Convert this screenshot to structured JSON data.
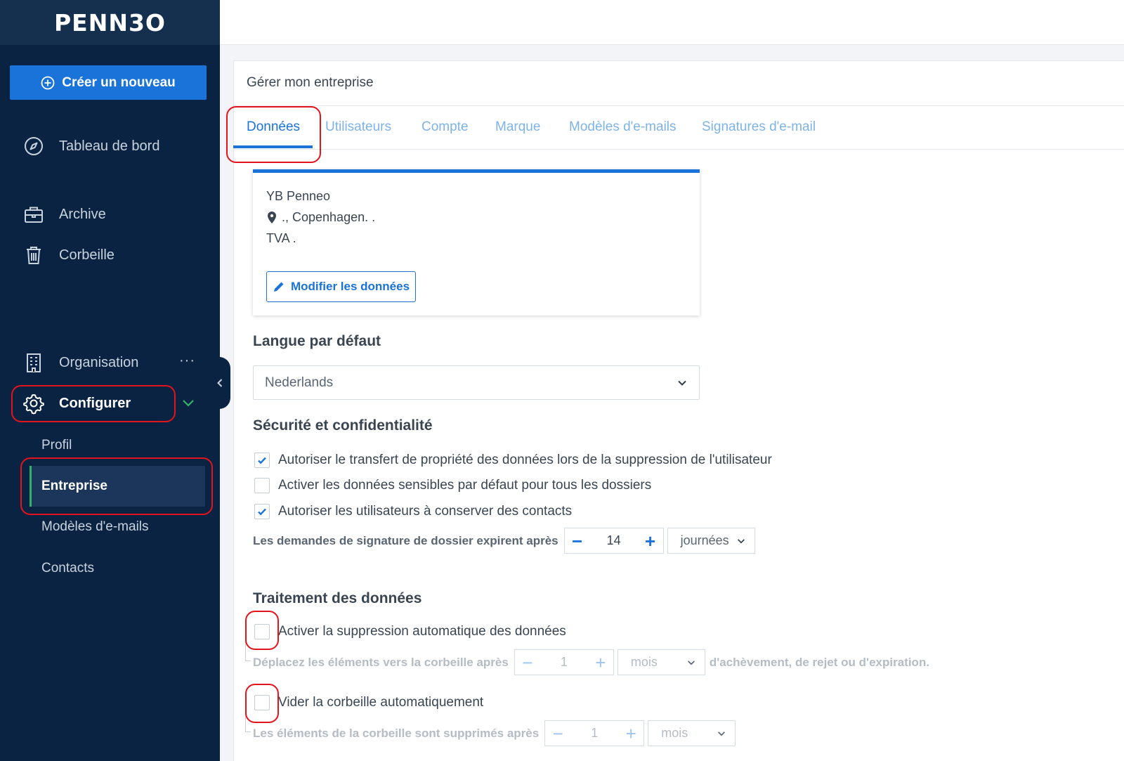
{
  "brand": {
    "logo": "PENN3O",
    "accent": "#1a73d9",
    "sidebar_bg": "#0a2342",
    "highlight": "#e3141c"
  },
  "sidebar": {
    "create_label": "Créer un nouveau",
    "items": [
      {
        "label": "Tableau de bord",
        "icon": "compass-icon"
      },
      {
        "label": "Archive",
        "icon": "briefcase-icon"
      },
      {
        "label": "Corbeille",
        "icon": "trash-icon"
      },
      {
        "label": "Organisation",
        "icon": "building-icon"
      },
      {
        "label": "Configurer",
        "icon": "gear-icon"
      }
    ],
    "more": "···",
    "subitems": [
      {
        "label": "Profil"
      },
      {
        "label": "Entreprise"
      },
      {
        "label": "Modèles d'e-mails"
      },
      {
        "label": "Contacts"
      }
    ]
  },
  "panel": {
    "title": "Gérer mon entreprise",
    "tabs": [
      {
        "label": "Données"
      },
      {
        "label": "Utilisateurs"
      },
      {
        "label": "Compte"
      },
      {
        "label": "Marque"
      },
      {
        "label": "Modèles d'e-mails"
      },
      {
        "label": "Signatures d'e-mail"
      }
    ]
  },
  "company": {
    "name": "YB Penneo",
    "address": "., Copenhagen. .",
    "vat": "TVA .",
    "edit_label": "Modifier les données"
  },
  "language": {
    "heading": "Langue par défaut",
    "selected": "Nederlands"
  },
  "security": {
    "heading": "Sécurité et confidentialité",
    "options": [
      {
        "label": "Autoriser le transfert de propriété des données lors de la suppression de l'utilisateur",
        "checked": true
      },
      {
        "label": "Activer les données sensibles par défaut pour tous les dossiers",
        "checked": false
      },
      {
        "label": "Autoriser les utilisateurs à conserver des contacts",
        "checked": true
      }
    ],
    "expiry_label": "Les demandes de signature de dossier expirent après",
    "expiry_value": "14",
    "expiry_unit": "journées"
  },
  "processing": {
    "heading": "Traitement des données",
    "auto_delete_label": "Activer la suppression automatique des données",
    "auto_delete_checked": false,
    "move_label": "Déplacez les éléments vers la corbeille après",
    "move_value": "1",
    "move_unit": "mois",
    "move_suffix": "d'achèvement, de rejet ou d'expiration.",
    "empty_trash_label": "Vider la corbeille automatiquement",
    "empty_trash_checked": false,
    "trash_label": "Les éléments de la corbeille sont supprimés après",
    "trash_value": "1",
    "trash_unit": "mois"
  }
}
